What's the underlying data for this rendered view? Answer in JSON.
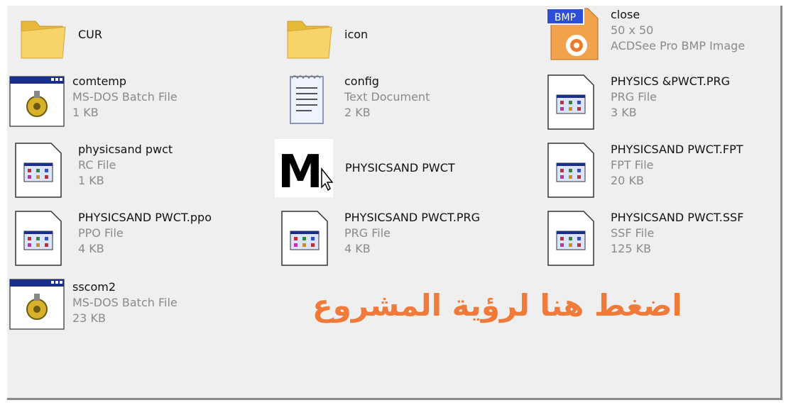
{
  "files": [
    {
      "name": "CUR",
      "type": "",
      "size": "",
      "icon": "folder-icon"
    },
    {
      "name": "icon",
      "type": "",
      "size": "",
      "icon": "folder-icon"
    },
    {
      "name": "close",
      "type": "50 x 50",
      "size": "ACDSee Pro BMP Image",
      "icon": "bmp-image-icon",
      "badge": "BMP"
    },
    {
      "name": "comtemp",
      "type": "MS-DOS Batch File",
      "size": "1 KB",
      "icon": "batch-file-icon"
    },
    {
      "name": "config",
      "type": "Text Document",
      "size": "2 KB",
      "icon": "text-document-icon"
    },
    {
      "name": "PHYSICS &PWCT.PRG",
      "type": "PRG File",
      "size": "3 KB",
      "icon": "generic-file-icon"
    },
    {
      "name": "physicsand pwct",
      "type": "RC File",
      "size": "1 KB",
      "icon": "generic-file-icon"
    },
    {
      "name": "PHYSICSAND PWCT",
      "type": "",
      "size": "",
      "icon": "m-app-icon",
      "glyph": "M"
    },
    {
      "name": "PHYSICSAND PWCT.FPT",
      "type": "FPT File",
      "size": "20 KB",
      "icon": "generic-file-icon"
    },
    {
      "name": "PHYSICSAND PWCT.ppo",
      "type": "PPO File",
      "size": "4 KB",
      "icon": "generic-file-icon"
    },
    {
      "name": "PHYSICSAND PWCT.PRG",
      "type": "PRG File",
      "size": "4 KB",
      "icon": "generic-file-icon"
    },
    {
      "name": "PHYSICSAND PWCT.SSF",
      "type": "SSF File",
      "size": "125 KB",
      "icon": "generic-file-icon"
    },
    {
      "name": "sscom2",
      "type": "MS-DOS Batch File",
      "size": "23 KB",
      "icon": "batch-file-icon"
    }
  ],
  "cta_text": "اضغط هنا لرؤية المشروع",
  "colors": {
    "cta": "#f07a3a",
    "pane": "#efefef",
    "folder": "#f3c84b",
    "bmp_badge": "#2c4fd8"
  }
}
